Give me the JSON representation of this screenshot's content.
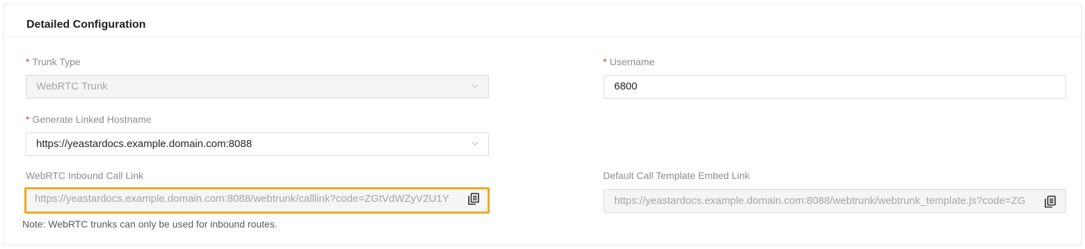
{
  "section": {
    "title": "Detailed Configuration"
  },
  "fields": {
    "trunk_type": {
      "label": "Trunk Type",
      "value": "WebRTC Trunk",
      "required": true
    },
    "username": {
      "label": "Username",
      "value": "6800",
      "required": true
    },
    "generate_linked_hostname": {
      "label": "Generate Linked Hostname",
      "value": "https://yeastardocs.example.domain.com:8088",
      "required": true
    },
    "inbound_call_link": {
      "label": "WebRTC Inbound Call Link",
      "value": "https://yeastardocs.example.domain.com:8088/webtrunk/calllink?code=ZGtVdWZyV2U1Y"
    },
    "default_call_template_embed_link": {
      "label": "Default Call Template Embed Link",
      "value": "https://yeastardocs.example.domain.com:8088/webtrunk/webtrunk_template.js?code=ZG"
    }
  },
  "required_mark": "*",
  "note": "Note: WebRTC trunks can only be used for inbound routes.",
  "icons": {
    "select_arrow": "chevron-down-icon",
    "copy": "copy-icon"
  },
  "colors": {
    "highlight_border": "#f0a81e",
    "required_mark": "#d9363e",
    "disabled_bg": "#f5f5f5"
  }
}
